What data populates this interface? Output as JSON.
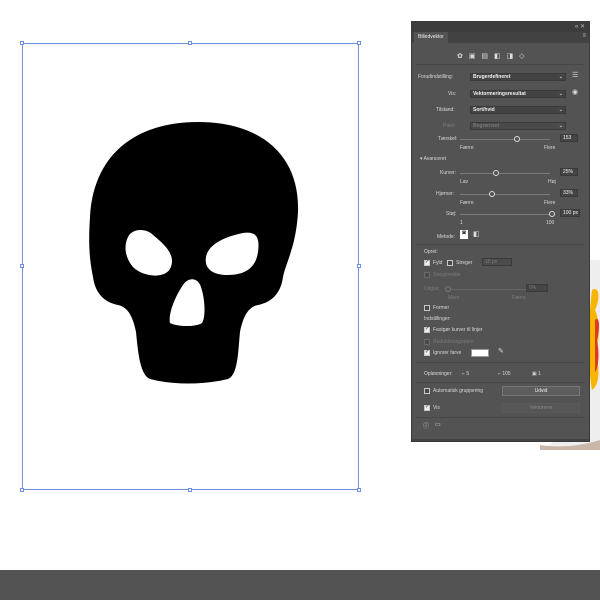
{
  "panel": {
    "tab_title": "Billedvektor",
    "top_controls": "«  ✕",
    "tab_menu": "≡",
    "preset_label": "Forudindstilling:",
    "preset_value": "Brugerdefineret",
    "view_label": "Vis:",
    "view_value": "Vektormeringsresultat",
    "mode_label": "Tilstand:",
    "mode_value": "Sort/hvid",
    "palette_label": "Palet:",
    "palette_value": "Begrænset",
    "threshold_label": "Tærskel:",
    "threshold_value": "153",
    "threshold_min": "Færre",
    "threshold_max": "Flere",
    "advanced_label": "Avanceret",
    "curves_label": "Kurver:",
    "curves_value": "25%",
    "curves_min": "Lav",
    "curves_max": "Høj",
    "corners_label": "Hjørner:",
    "corners_value": "33%",
    "corners_min": "Færre",
    "corners_max": "Flere",
    "noise_label": "Støj:",
    "noise_value": "100 px",
    "noise_min": "1",
    "noise_max": "100",
    "method_label": "Metode:",
    "create_label": "Opret:",
    "fill_label": "Fyld",
    "strokes_label": "Streger",
    "stroke_value": "10 px",
    "stroke_width_label": "Stregbredde",
    "snap_label": "Udglat:",
    "snap_value": "0%",
    "snap_min": "Mere",
    "snap_max": "Færre",
    "shapes_label": "Former",
    "options_label": "Indstillinger:",
    "snap_curves_label": "Fastgør kurver til linjer",
    "ignore_white_dim_label": "Reduktionsgraden",
    "ignore_color_label": "Ignorer farve",
    "paths_label": "Opløsninger:",
    "paths_value": "5",
    "anchors_value": "105",
    "colors_value": "1",
    "auto_group_label": "Automatisk gruppering",
    "expand_button": "Udvid",
    "preview_label": "Vis",
    "trace_button": "Vektorerer"
  },
  "colors": {
    "panel_bg": "#535353",
    "artboard_border": "#6f8fe0",
    "bottom_bar": "#535353"
  }
}
